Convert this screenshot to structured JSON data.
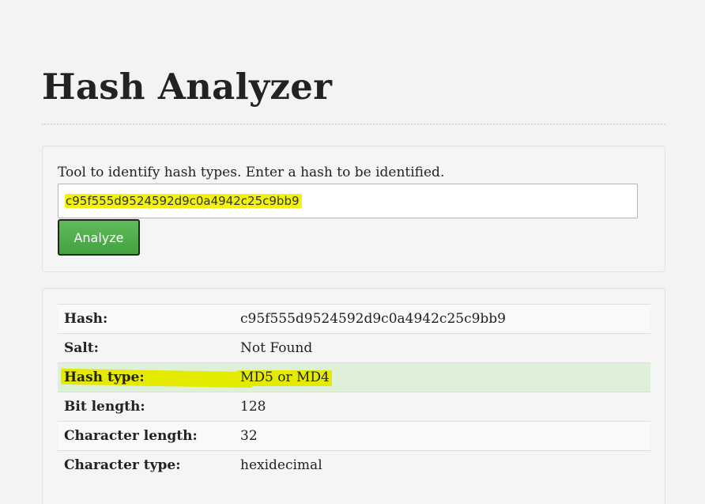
{
  "page": {
    "title": "Hash Analyzer"
  },
  "form": {
    "instructions": "Tool to identify hash types. Enter a hash to be identified.",
    "hash_value": "c95f555d9524592d9c0a4942c25c9bb9",
    "submit_label": "Analyze"
  },
  "results": {
    "rows": [
      {
        "label": "Hash:",
        "value": "c95f555d9524592d9c0a4942c25c9bb9"
      },
      {
        "label": "Salt:",
        "value": "Not Found"
      },
      {
        "label": "Hash type:",
        "value": "MD5 or MD4"
      },
      {
        "label": "Bit length:",
        "value": "128"
      },
      {
        "label": "Character length:",
        "value": "32"
      },
      {
        "label": "Character type:",
        "value": "hexidecimal"
      }
    ]
  },
  "colors": {
    "accent_button": "#4cae48",
    "success_row": "#dff0d8",
    "highlight": "#e4ea00"
  }
}
